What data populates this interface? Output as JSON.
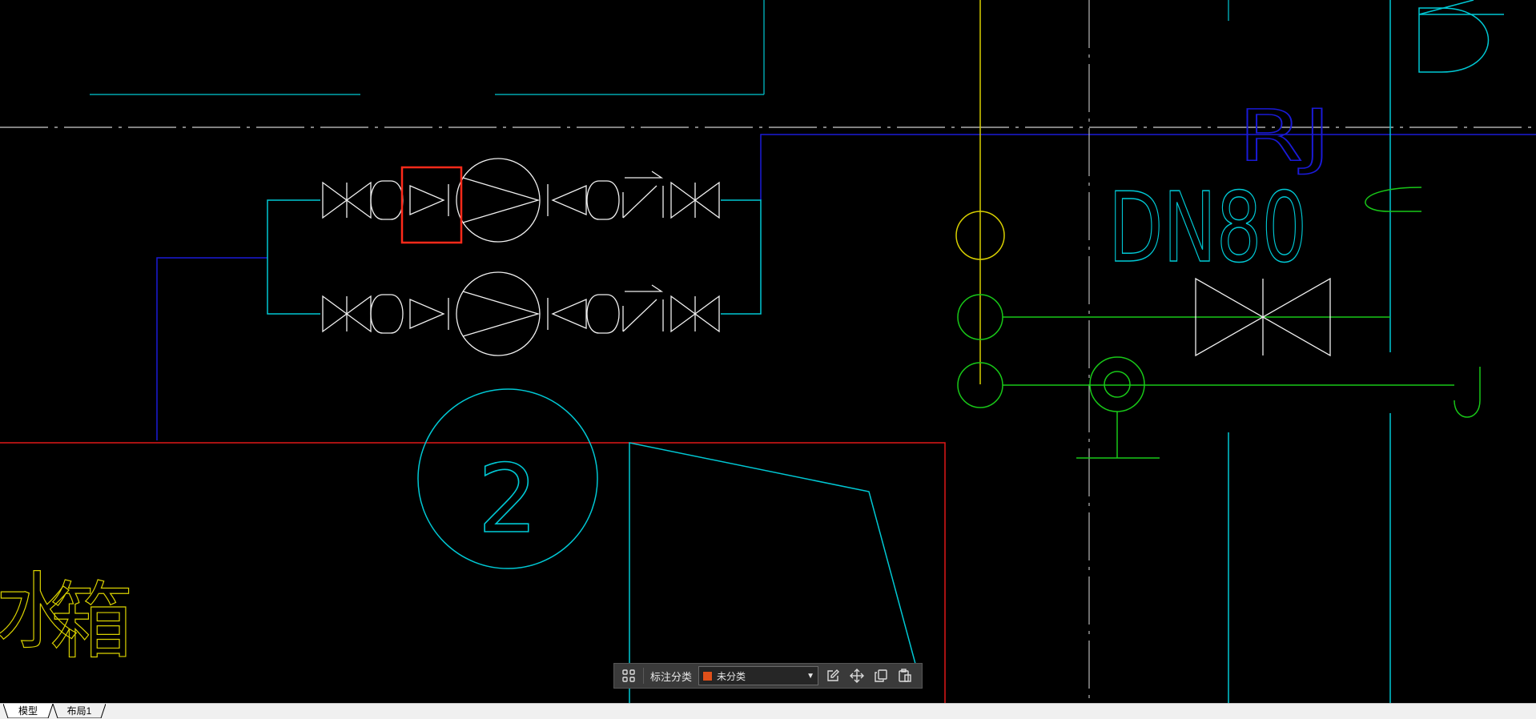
{
  "drawing": {
    "pump_number": "2",
    "pipe_size_label": "DN80",
    "pipe_code_label": "RJ",
    "tank_label_line1": "水",
    "tank_label_line2": "箱",
    "tank_label_prefix": "",
    "colors": {
      "background": "#000000",
      "cyan": "#00c8d4",
      "blue": "#1a1ad8",
      "yellow": "#d8d000",
      "green": "#18c818",
      "white": "#f0f0f0",
      "red": "#e01818",
      "selection": "#ff2a1a"
    }
  },
  "annotation_toolbar": {
    "category_label": "标注分类",
    "selected_category": "未分类",
    "selected_color": "#e0501a",
    "icons": [
      "grid-icon",
      "edit-icon",
      "move-icon",
      "copy-icon",
      "paste-icon"
    ]
  },
  "tabs": [
    {
      "label": "模型",
      "active": true
    },
    {
      "label": "布局1",
      "active": false
    }
  ]
}
